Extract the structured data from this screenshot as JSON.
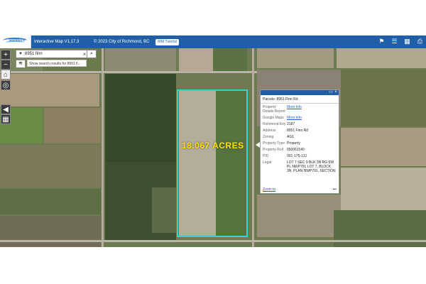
{
  "header": {
    "logo_text": "Richmond",
    "app_title": "Interactive Map V1.17.3",
    "copyright": "© 2023 City of Richmond, BC",
    "tutorial_button": "RIM Tutorial",
    "right_icons": [
      "layers-icon",
      "list-icon",
      "table-icon",
      "print-icon"
    ],
    "color": "#1f5fa8"
  },
  "search": {
    "value": "8951 finn",
    "suggestion": "Show search results for 8951 fi..."
  },
  "map": {
    "acres_label": "18.067 ACRES",
    "parcel_outline_color": "#2fd6d0",
    "label_color": "#ffe100"
  },
  "popup": {
    "title": "Parcels: 8951 Finn Rd",
    "rows": [
      {
        "label": "Property Details Report",
        "value": "More info",
        "link": true
      },
      {
        "label": "Google Maps",
        "value": "More info",
        "link": true
      },
      {
        "label": "Richmond Key",
        "value": "2187",
        "link": false
      },
      {
        "label": "Address",
        "value": "8951 Finn Rd",
        "link": false
      },
      {
        "label": "Zoning",
        "value": "AG1",
        "link": false
      },
      {
        "label": "Property Type",
        "value": "Property",
        "link": false
      },
      {
        "label": "Property Roll",
        "value": "050061140",
        "link": false
      },
      {
        "label": "PID",
        "value": "001-175-131",
        "link": false
      },
      {
        "label": "Legal",
        "value": "LOT 7 SEC 9 BLK 3N RG 6W PL NWP791 LOT 7, BLOCK 3N, PLAN NWP791, SECTION",
        "link": false
      }
    ],
    "zoom_link": "Zoom to",
    "more": "•••"
  }
}
